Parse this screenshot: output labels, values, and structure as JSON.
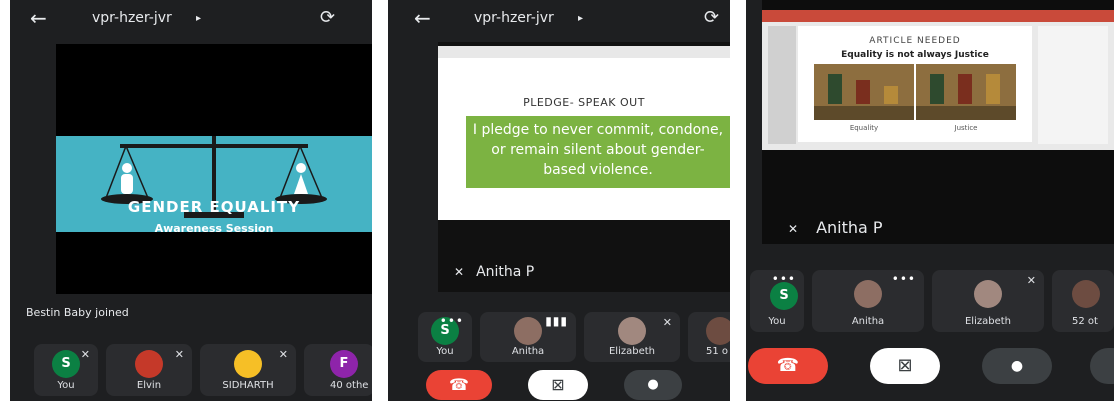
{
  "meeting": {
    "code": "vpr-hzer-jvr",
    "caret": "▸"
  },
  "icons": {
    "back": "←",
    "rotate": "⟳",
    "mic_off": "🎙̸",
    "mic": "🎤",
    "end_call": "☎",
    "camera": "⊠"
  },
  "panel1": {
    "slide_title": "GENDER EQUALITY",
    "slide_subtitle": "Awareness Session",
    "join_notice": "Bestin Baby joined",
    "participants": [
      {
        "initial": "S",
        "label": "You",
        "color": "#0b8043"
      },
      {
        "initial": "",
        "label": "Elvin",
        "color": "#c53929"
      },
      {
        "initial": "",
        "label": "SIDHARTH",
        "color": "#f6bf26"
      },
      {
        "initial": "F",
        "label": "40 othe",
        "color": "#8e24aa"
      }
    ]
  },
  "panel2": {
    "slide_title": "PLEDGE- SPEAK OUT",
    "pledge_text": "I pledge to never commit, condone, or remain silent about gender-based violence.",
    "presenter": "Anitha P",
    "participants": [
      {
        "initial": "S",
        "label": "You",
        "color": "#0b8043"
      },
      {
        "initial": "",
        "label": "Anitha",
        "color": "#8d6e63"
      },
      {
        "initial": "",
        "label": "Elizabeth",
        "color": "#a1887f"
      },
      {
        "initial": "",
        "label": "51 o",
        "color": "#6d4c41"
      }
    ]
  },
  "panel3": {
    "slide_title": "ARTICLE NEEDED",
    "slide_subtitle": "Equality is not always Justice",
    "caption_left": "Equality",
    "caption_right": "Justice",
    "presenter": "Anitha P",
    "participants": [
      {
        "initial": "S",
        "label": "You",
        "color": "#0b8043"
      },
      {
        "initial": "",
        "label": "Anitha",
        "color": "#8d6e63"
      },
      {
        "initial": "",
        "label": "Elizabeth",
        "color": "#a1887f"
      },
      {
        "initial": "",
        "label": "52 ot",
        "color": "#6d4c41"
      }
    ]
  }
}
